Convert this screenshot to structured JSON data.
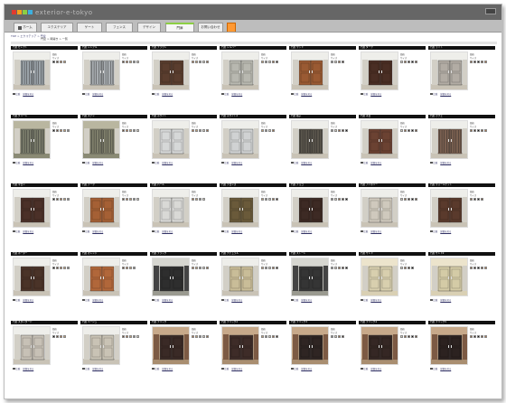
{
  "app": {
    "logo_text": "exterior-e-tokyo"
  },
  "brand_colors": [
    "#e23b2f",
    "#f7a21c",
    "#8ccf43",
    "#3cb0e0"
  ],
  "tabs": [
    {
      "label": "ホーム",
      "key": "home"
    },
    {
      "label": "エクステリア",
      "key": "ext"
    },
    {
      "label": "ゲート",
      "key": "gate"
    },
    {
      "label": "フェンス",
      "key": "fence"
    },
    {
      "label": "デザイン",
      "key": "design"
    },
    {
      "label": "門扉",
      "key": "mon"
    },
    {
      "label": "お問い合わせ",
      "key": "contact"
    },
    {
      "label": "",
      "key": "extra"
    }
  ],
  "breadcrumb": "TOP > エクステリア > 門扉",
  "subheading": "門扉 > 両開き > 一覧",
  "labels": {
    "price": "価格",
    "size": "サイズ",
    "detail": "詳細を見る",
    "compare": "比較"
  },
  "rows": [
    [
      {
        "title": "門扉 セレクト",
        "style": "grey-glass",
        "accent": "#9aa2a8"
      },
      {
        "title": "門扉 シンプル",
        "style": "grey-glass",
        "accent": "#a7acb0"
      },
      {
        "title": "門扉 ブラウン",
        "style": "brown",
        "accent": "#5a3d2e"
      },
      {
        "title": "門扉 シルバー",
        "style": "silver",
        "accent": "#b8b8b0"
      },
      {
        "title": "門扉 ウッド",
        "style": "orange-wood",
        "accent": "#9a5a33"
      },
      {
        "title": "門扉 ダーク",
        "style": "dark-brown",
        "accent": "#4a2e24"
      },
      {
        "title": "門扉 ライト",
        "style": "light",
        "accent": "#b2aca4"
      }
    ],
    [
      {
        "title": "門扉 グリーン",
        "style": "greenwall",
        "accent": "#7b7d6c"
      },
      {
        "title": "門扉 ステン",
        "style": "greenwall",
        "accent": "#80806c"
      },
      {
        "title": "門扉 ホワイト",
        "style": "white",
        "accent": "#d6d8d8"
      },
      {
        "title": "門扉 ホワイト2",
        "style": "white",
        "accent": "#d0d2d3"
      },
      {
        "title": "門扉 格子",
        "style": "lattice",
        "accent": "#5a554c"
      },
      {
        "title": "門扉 木目",
        "style": "brown",
        "accent": "#6b4232"
      },
      {
        "title": "門扉 カフェ",
        "style": "lattice",
        "accent": "#7a6050"
      }
    ],
    [
      {
        "title": "門扉 マロン",
        "style": "dark-brown",
        "accent": "#4b3028"
      },
      {
        "title": "門扉 チーク",
        "style": "orange-wood",
        "accent": "#a56035"
      },
      {
        "title": "門扉 パール",
        "style": "white",
        "accent": "#d9d9d6"
      },
      {
        "title": "門扉 ブロンズ",
        "style": "bronze",
        "accent": "#6a5a3a"
      },
      {
        "title": "門扉 チョコ",
        "style": "dark-brown",
        "accent": "#3d2a24"
      },
      {
        "title": "門扉 アイボリー",
        "style": "light",
        "accent": "#cfc9bd"
      },
      {
        "title": "門扉 ウォールナット",
        "style": "brown",
        "accent": "#5a3a2c"
      }
    ],
    [
      {
        "title": "門扉 ボーダー",
        "style": "dark-brown",
        "accent": "#4a3328"
      },
      {
        "title": "門扉 オレンジ",
        "style": "orange-wood",
        "accent": "#b1673a"
      },
      {
        "title": "門扉 ブラック",
        "style": "black-stone",
        "accent": "#2e2e2e"
      },
      {
        "title": "門扉 ナチュラル",
        "style": "beige",
        "accent": "#c9bd98"
      },
      {
        "title": "門扉 ストーン",
        "style": "black-stone",
        "accent": "#353535"
      },
      {
        "title": "門扉 サンド",
        "style": "beige-wall",
        "accent": "#d8cfae"
      },
      {
        "title": "門扉 サンド2",
        "style": "beige-wall",
        "accent": "#d4cba6"
      }
    ],
    [
      {
        "title": "門扉 スタンダード",
        "style": "light",
        "accent": "#c7c1b6"
      },
      {
        "title": "門扉 ベージュ",
        "style": "light",
        "accent": "#c9c3b5"
      },
      {
        "title": "門扉 ブリック",
        "style": "brick",
        "accent": "#3a2a26"
      },
      {
        "title": "門扉 ブリック2",
        "style": "brick",
        "accent": "#3e2c28"
      },
      {
        "title": "門扉 ブリック3",
        "style": "brick",
        "accent": "#2f2523"
      },
      {
        "title": "門扉 ブリック4",
        "style": "brick",
        "accent": "#352724"
      },
      {
        "title": "門扉 ブリック5",
        "style": "brick",
        "accent": "#2c2220"
      }
    ]
  ],
  "swatch_colors": [
    "#111111",
    "#6b4a33",
    "#b8794a",
    "#c9a070",
    "#888888",
    "#d8d0c0",
    "#9a6b44",
    "#3a2a22"
  ]
}
